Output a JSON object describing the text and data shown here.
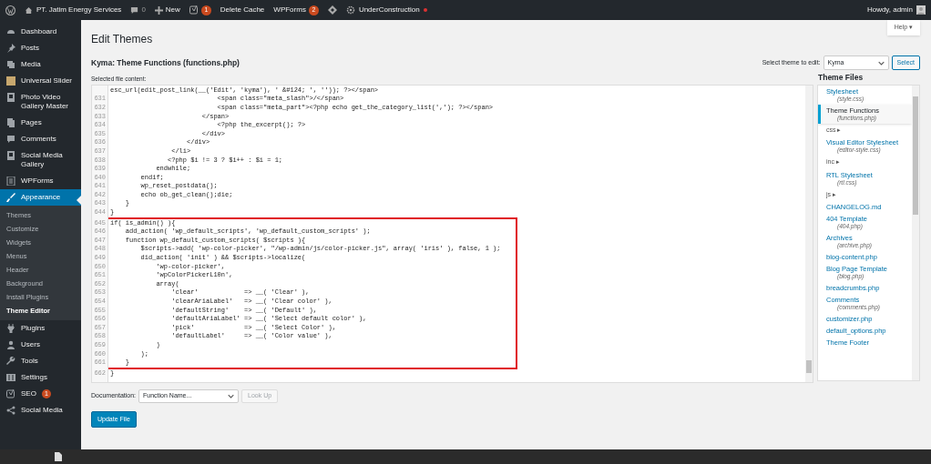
{
  "admin_bar": {
    "site": "PT. Jatim Energy Services",
    "comments": "0",
    "new": "New",
    "seo_count": "1",
    "delete_cache": "Delete Cache",
    "wpforms": "WPForms",
    "wpforms_count": "2",
    "under_construction": "UnderConstruction",
    "greeting": "Howdy, admin"
  },
  "sidebar": {
    "items": [
      {
        "label": "Dashboard",
        "selected": false
      },
      {
        "label": "Posts",
        "selected": false
      },
      {
        "label": "Media",
        "selected": false
      },
      {
        "label": "Universal Slider",
        "selected": false
      },
      {
        "label": "Photo Video Gallery Master",
        "selected": false
      },
      {
        "label": "Pages",
        "selected": false
      },
      {
        "label": "Comments",
        "selected": false
      },
      {
        "label": "Social Media Gallery",
        "selected": false
      },
      {
        "label": "WPForms",
        "selected": false
      },
      {
        "label": "Appearance",
        "selected": true,
        "children": [
          {
            "label": "Themes",
            "selected": false
          },
          {
            "label": "Customize",
            "selected": false
          },
          {
            "label": "Widgets",
            "selected": false
          },
          {
            "label": "Menus",
            "selected": false
          },
          {
            "label": "Header",
            "selected": false
          },
          {
            "label": "Background",
            "selected": false
          },
          {
            "label": "Install Plugins",
            "selected": false
          },
          {
            "label": "Theme Editor",
            "selected": true
          }
        ]
      },
      {
        "label": "Plugins",
        "selected": false
      },
      {
        "label": "Users",
        "selected": false
      },
      {
        "label": "Tools",
        "selected": false
      },
      {
        "label": "Settings",
        "selected": false
      },
      {
        "label": "SEO",
        "selected": false,
        "badge": "1"
      },
      {
        "label": "Social Media",
        "selected": false
      }
    ]
  },
  "page": {
    "title": "Edit Themes",
    "help": "Help ▾",
    "file_title": "Kyma: Theme Functions (functions.php)",
    "theme_select_label": "Select theme to edit:",
    "theme_select_value": "Kyma",
    "select_button": "Select",
    "content_label": "Selected file content:"
  },
  "code": {
    "lines": [
      {
        "text": "esc_url(edit_post_link(__('Edit', 'kyma'), ' &#124; ', '')); ?></span>",
        "boxed": false
      },
      {
        "number": "631",
        "text": "                            <span class=\"meta_slash\">/</span>",
        "boxed": false
      },
      {
        "number": "632",
        "text": "                            <span class=\"meta_part\"><?php echo get_the_category_list(','); ?></span>",
        "boxed": false
      },
      {
        "number": "633",
        "text": "                        </span>",
        "boxed": false
      },
      {
        "number": "634",
        "text": "                            <?php the_excerpt(); ?>",
        "boxed": false
      },
      {
        "number": "635",
        "text": "                        </div>",
        "boxed": false
      },
      {
        "number": "636",
        "text": "                    </div>",
        "boxed": false
      },
      {
        "number": "637",
        "text": "                </li>",
        "boxed": false
      },
      {
        "number": "638",
        "text": "               <?php $i != 3 ? $i++ : $i = 1;",
        "boxed": false
      },
      {
        "number": "639",
        "text": "            endwhile;",
        "boxed": false
      },
      {
        "number": "640",
        "text": "        endif;",
        "boxed": false
      },
      {
        "number": "641",
        "text": "        wp_reset_postdata();",
        "boxed": false
      },
      {
        "number": "642",
        "text": "        echo ob_get_clean();die;",
        "boxed": false
      },
      {
        "number": "643",
        "text": "    }",
        "boxed": false
      },
      {
        "number": "644",
        "text": "}",
        "boxed": false
      },
      {
        "number": "645",
        "text": "if( is_admin() ){",
        "boxed": true
      },
      {
        "number": "646",
        "text": "    add_action( 'wp_default_scripts', 'wp_default_custom_scripts' );",
        "boxed": true
      },
      {
        "number": "647",
        "text": "    function wp_default_custom_scripts( $scripts ){",
        "boxed": true
      },
      {
        "number": "648",
        "text": "        $scripts->add( 'wp-color-picker', \"/wp-admin/js/color-picker.js\", array( 'iris' ), false, 1 );",
        "boxed": true
      },
      {
        "number": "649",
        "text": "        did_action( 'init' ) && $scripts->localize(",
        "boxed": true
      },
      {
        "number": "650",
        "text": "            'wp-color-picker',",
        "boxed": true
      },
      {
        "number": "651",
        "text": "            'wpColorPickerL10n',",
        "boxed": true
      },
      {
        "number": "652",
        "text": "            array(",
        "boxed": true
      },
      {
        "number": "653",
        "text": "                'clear'            => __( 'Clear' ),",
        "boxed": true
      },
      {
        "number": "654",
        "text": "                'clearAriaLabel'   => __( 'Clear color' ),",
        "boxed": true
      },
      {
        "number": "655",
        "text": "                'defaultString'    => __( 'Default' ),",
        "boxed": true
      },
      {
        "number": "656",
        "text": "                'defaultAriaLabel' => __( 'Select default color' ),",
        "boxed": true
      },
      {
        "number": "657",
        "text": "                'pick'             => __( 'Select Color' ),",
        "boxed": true
      },
      {
        "number": "658",
        "text": "                'defaultLabel'     => __( 'Color value' ),",
        "boxed": true
      },
      {
        "number": "659",
        "text": "            )",
        "boxed": true
      },
      {
        "number": "660",
        "text": "        );",
        "boxed": true
      },
      {
        "number": "661",
        "text": "    }",
        "boxed": true
      },
      {
        "number": "662",
        "text": "}",
        "boxed": false
      }
    ]
  },
  "theme_files": {
    "heading": "Theme Files",
    "items": [
      {
        "kind": "file",
        "name": "Stylesheet",
        "file": "(style.css)",
        "selected": false
      },
      {
        "kind": "file",
        "name": "Theme Functions",
        "file": "(functions.php)",
        "selected": true
      },
      {
        "kind": "folder",
        "name": "css ▸",
        "selected": false
      },
      {
        "kind": "file",
        "name": "Visual Editor Stylesheet",
        "file": "(editor-style.css)",
        "selected": false
      },
      {
        "kind": "folder",
        "name": "inc ▸",
        "selected": false
      },
      {
        "kind": "file",
        "name": "RTL Stylesheet",
        "file": "(rtl.css)",
        "selected": false
      },
      {
        "kind": "folder",
        "name": "js ▸",
        "selected": false
      },
      {
        "kind": "file",
        "name": "CHANGELOG.md",
        "selected": false
      },
      {
        "kind": "file",
        "name": "404 Template",
        "file": "(404.php)",
        "selected": false
      },
      {
        "kind": "file",
        "name": "Archives",
        "file": "(archive.php)",
        "selected": false
      },
      {
        "kind": "file",
        "name": "blog-content.php",
        "selected": false
      },
      {
        "kind": "file",
        "name": "Blog Page Template",
        "file": "(blog.php)",
        "selected": false
      },
      {
        "kind": "file",
        "name": "breadcrumbs.php",
        "selected": false
      },
      {
        "kind": "file",
        "name": "Comments",
        "file": "(comments.php)",
        "selected": false
      },
      {
        "kind": "file",
        "name": "customizer.php",
        "selected": false
      },
      {
        "kind": "file",
        "name": "default_options.php",
        "selected": false
      },
      {
        "kind": "file",
        "name": "Theme Footer",
        "selected": false
      }
    ]
  },
  "footer": {
    "documentation_label": "Documentation:",
    "function_select": "Function Name...",
    "lookup_button": "Look Up",
    "lookup_disabled": true,
    "update_button": "Update File"
  }
}
